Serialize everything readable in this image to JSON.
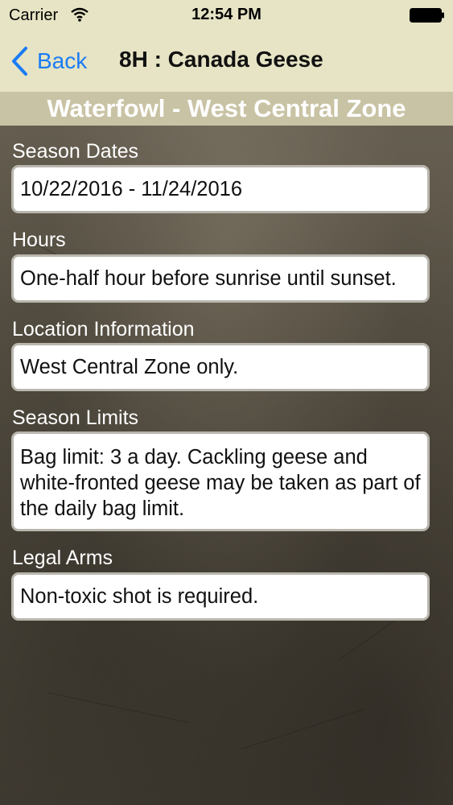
{
  "status_bar": {
    "carrier": "Carrier",
    "time": "12:54 PM"
  },
  "nav": {
    "back_label": "Back",
    "title": "8H : Canada Geese"
  },
  "zone_header": "Waterfowl - West Central Zone",
  "sections": [
    {
      "label": "Season Dates",
      "value": "10/22/2016 - 11/24/2016"
    },
    {
      "label": "Hours",
      "value": "One-half hour before sunrise until sunset."
    },
    {
      "label": "Location Information",
      "value": "West Central Zone only."
    },
    {
      "label": "Season Limits",
      "value": "Bag limit: 3 a day. Cackling geese and white-fronted geese may be taken as part of the daily bag limit."
    },
    {
      "label": "Legal Arms",
      "value": "Non-toxic shot is required."
    }
  ],
  "colors": {
    "nav_background": "#e6e4c4",
    "back_link": "#1a7bf5",
    "zone_header_background": "#c9c3a5",
    "section_label": "#ffffff"
  },
  "icons": {
    "wifi": "wifi-icon",
    "battery": "battery-icon",
    "back": "chevron-left-icon"
  }
}
